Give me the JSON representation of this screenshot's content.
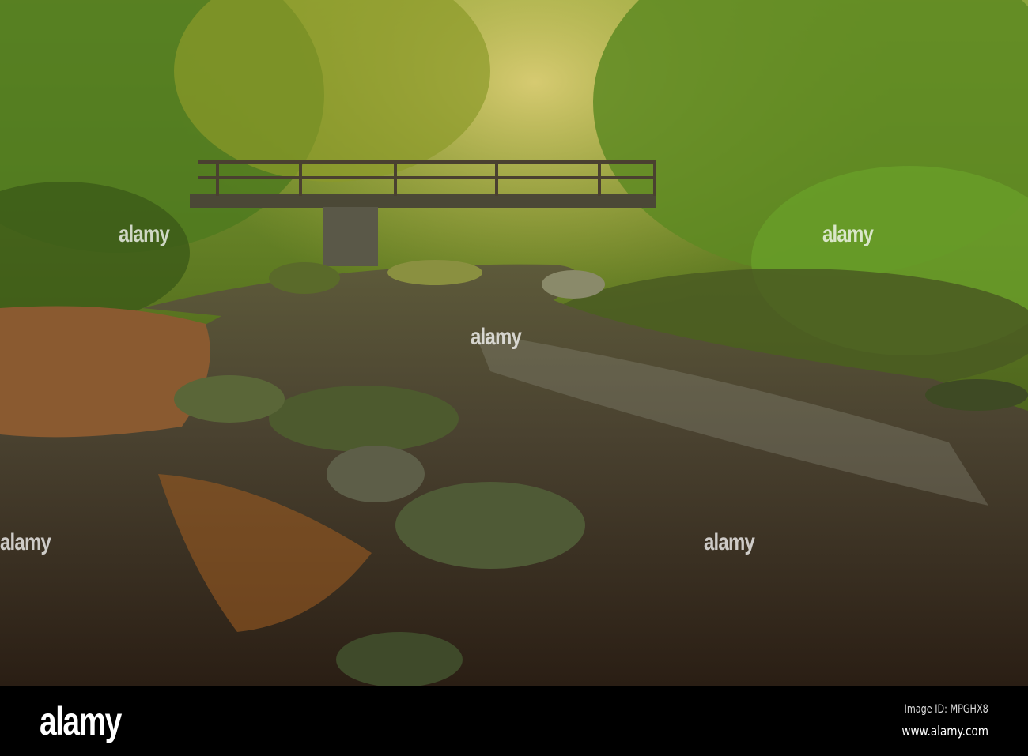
{
  "watermark": {
    "text": "alamy"
  },
  "footer": {
    "logo": "alamy",
    "image_id": "Image ID: MPGHX8",
    "url": "www.alamy.com"
  }
}
